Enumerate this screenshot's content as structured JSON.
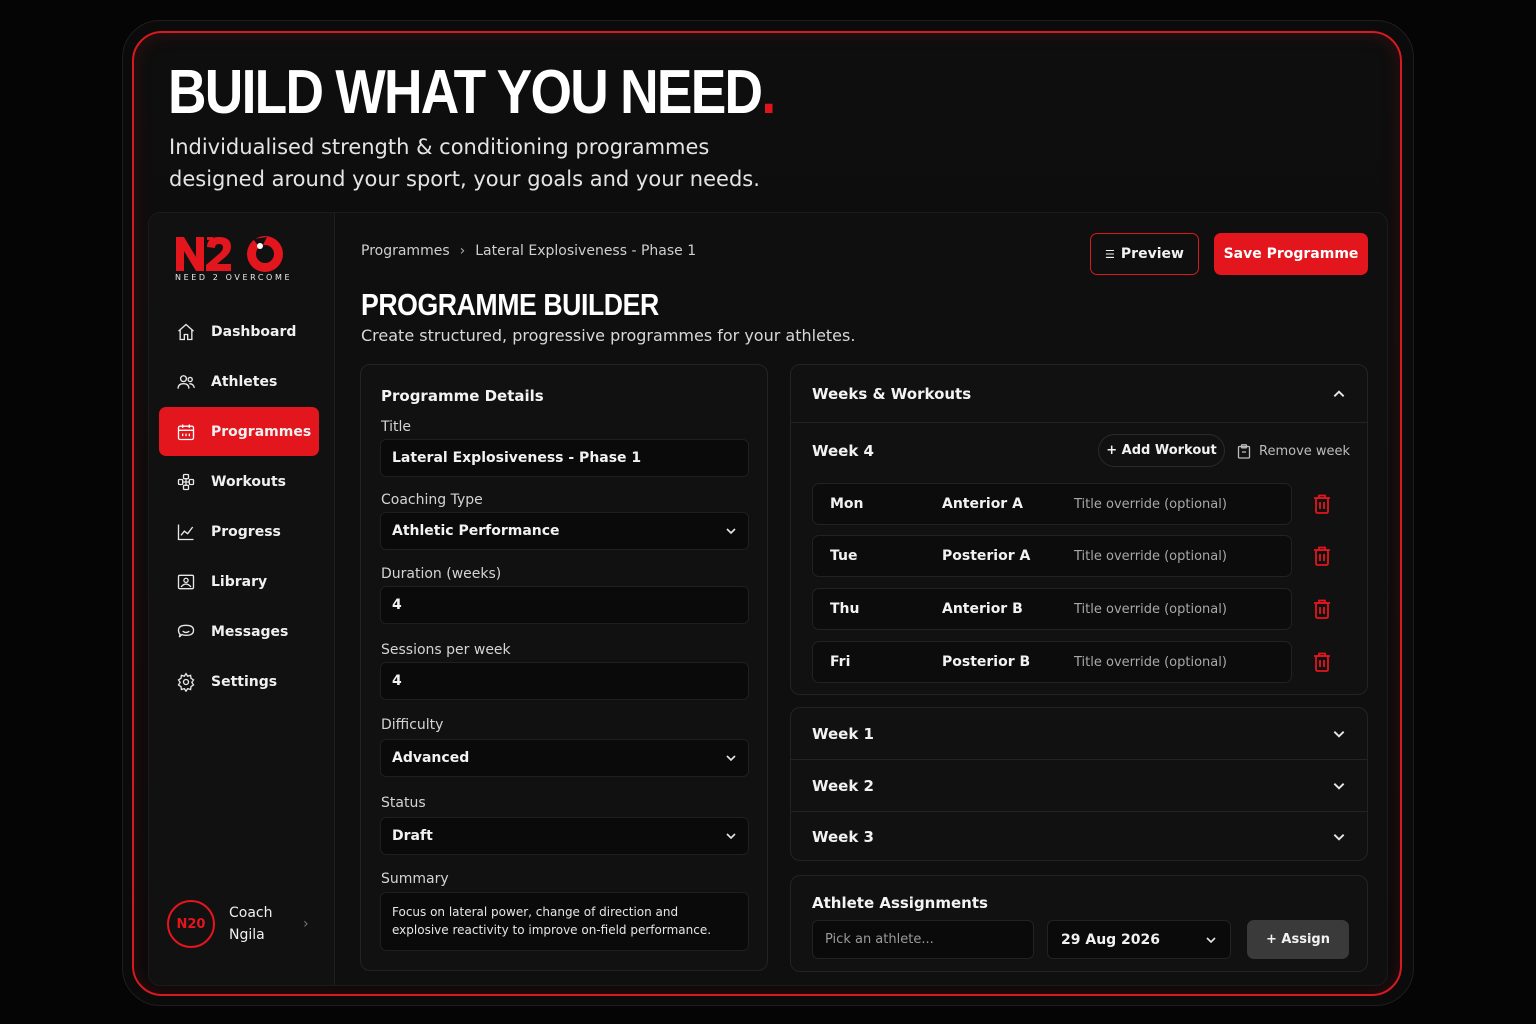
{
  "hero": {
    "title": "BUILD WHAT YOU NEED",
    "title_dot": ".",
    "subtitle": "Individualised strength & conditioning programmes designed around your sport, your goals and your needs."
  },
  "brand": {
    "logo_text": "N2O",
    "tagline": "NEED 2 OVERCOME",
    "accent": "#e3151d"
  },
  "sidebar": {
    "items": [
      {
        "label": "Dashboard",
        "icon": "home-icon"
      },
      {
        "label": "Athletes",
        "icon": "users-icon"
      },
      {
        "label": "Programmes",
        "icon": "calendar-icon",
        "active": true
      },
      {
        "label": "Workouts",
        "icon": "dumbbell-icon"
      },
      {
        "label": "Progress",
        "icon": "chart-line-icon"
      },
      {
        "label": "Library",
        "icon": "image-icon"
      },
      {
        "label": "Messages",
        "icon": "chat-icon"
      },
      {
        "label": "Settings",
        "icon": "gear-icon"
      }
    ],
    "coach": {
      "avatar": "N20",
      "name": "Coach Ngila"
    }
  },
  "header": {
    "breadcrumb": [
      "Programmes",
      "Lateral Explosiveness - Phase 1"
    ],
    "preview_label": "Preview",
    "save_label": "Save Programme",
    "title": "PROGRAMME BUILDER",
    "subtitle": "Create structured, progressive programmes for your athletes."
  },
  "details": {
    "heading": "Programme Details",
    "title_label": "Title",
    "title_value": "Lateral Explosiveness - Phase 1",
    "coaching_label": "Coaching Type",
    "coaching_value": "Athletic Performance",
    "duration_label": "Duration (weeks)",
    "duration_value": "4",
    "sessions_label": "Sessions per week",
    "sessions_value": "4",
    "difficulty_label": "Difficulty",
    "difficulty_value": "Advanced",
    "status_label": "Status",
    "status_value": "Draft",
    "summary_label": "Summary",
    "summary_value": "Focus on lateral power, change of direction and explosive reactivity to improve on-field performance."
  },
  "weeks": {
    "heading": "Weeks & Workouts",
    "open_week": {
      "label": "Week 4",
      "add_label": "+ Add Workout",
      "remove_label": "Remove week",
      "days": [
        {
          "day": "Mon",
          "workout": "Anterior A",
          "override_placeholder": "Title override (optional)"
        },
        {
          "day": "Tue",
          "workout": "Posterior A",
          "override_placeholder": "Title override (optional)"
        },
        {
          "day": "Thu",
          "workout": "Anterior B",
          "override_placeholder": "Title override (optional)"
        },
        {
          "day": "Fri",
          "workout": "Posterior B",
          "override_placeholder": "Title override (optional)"
        }
      ]
    },
    "collapsed": [
      "Week 1",
      "Week 2",
      "Week 3"
    ]
  },
  "assignments": {
    "heading": "Athlete Assignments",
    "athlete_placeholder": "Pick an athlete...",
    "date_value": "29 Aug 2026",
    "assign_label": "+ Assign"
  }
}
